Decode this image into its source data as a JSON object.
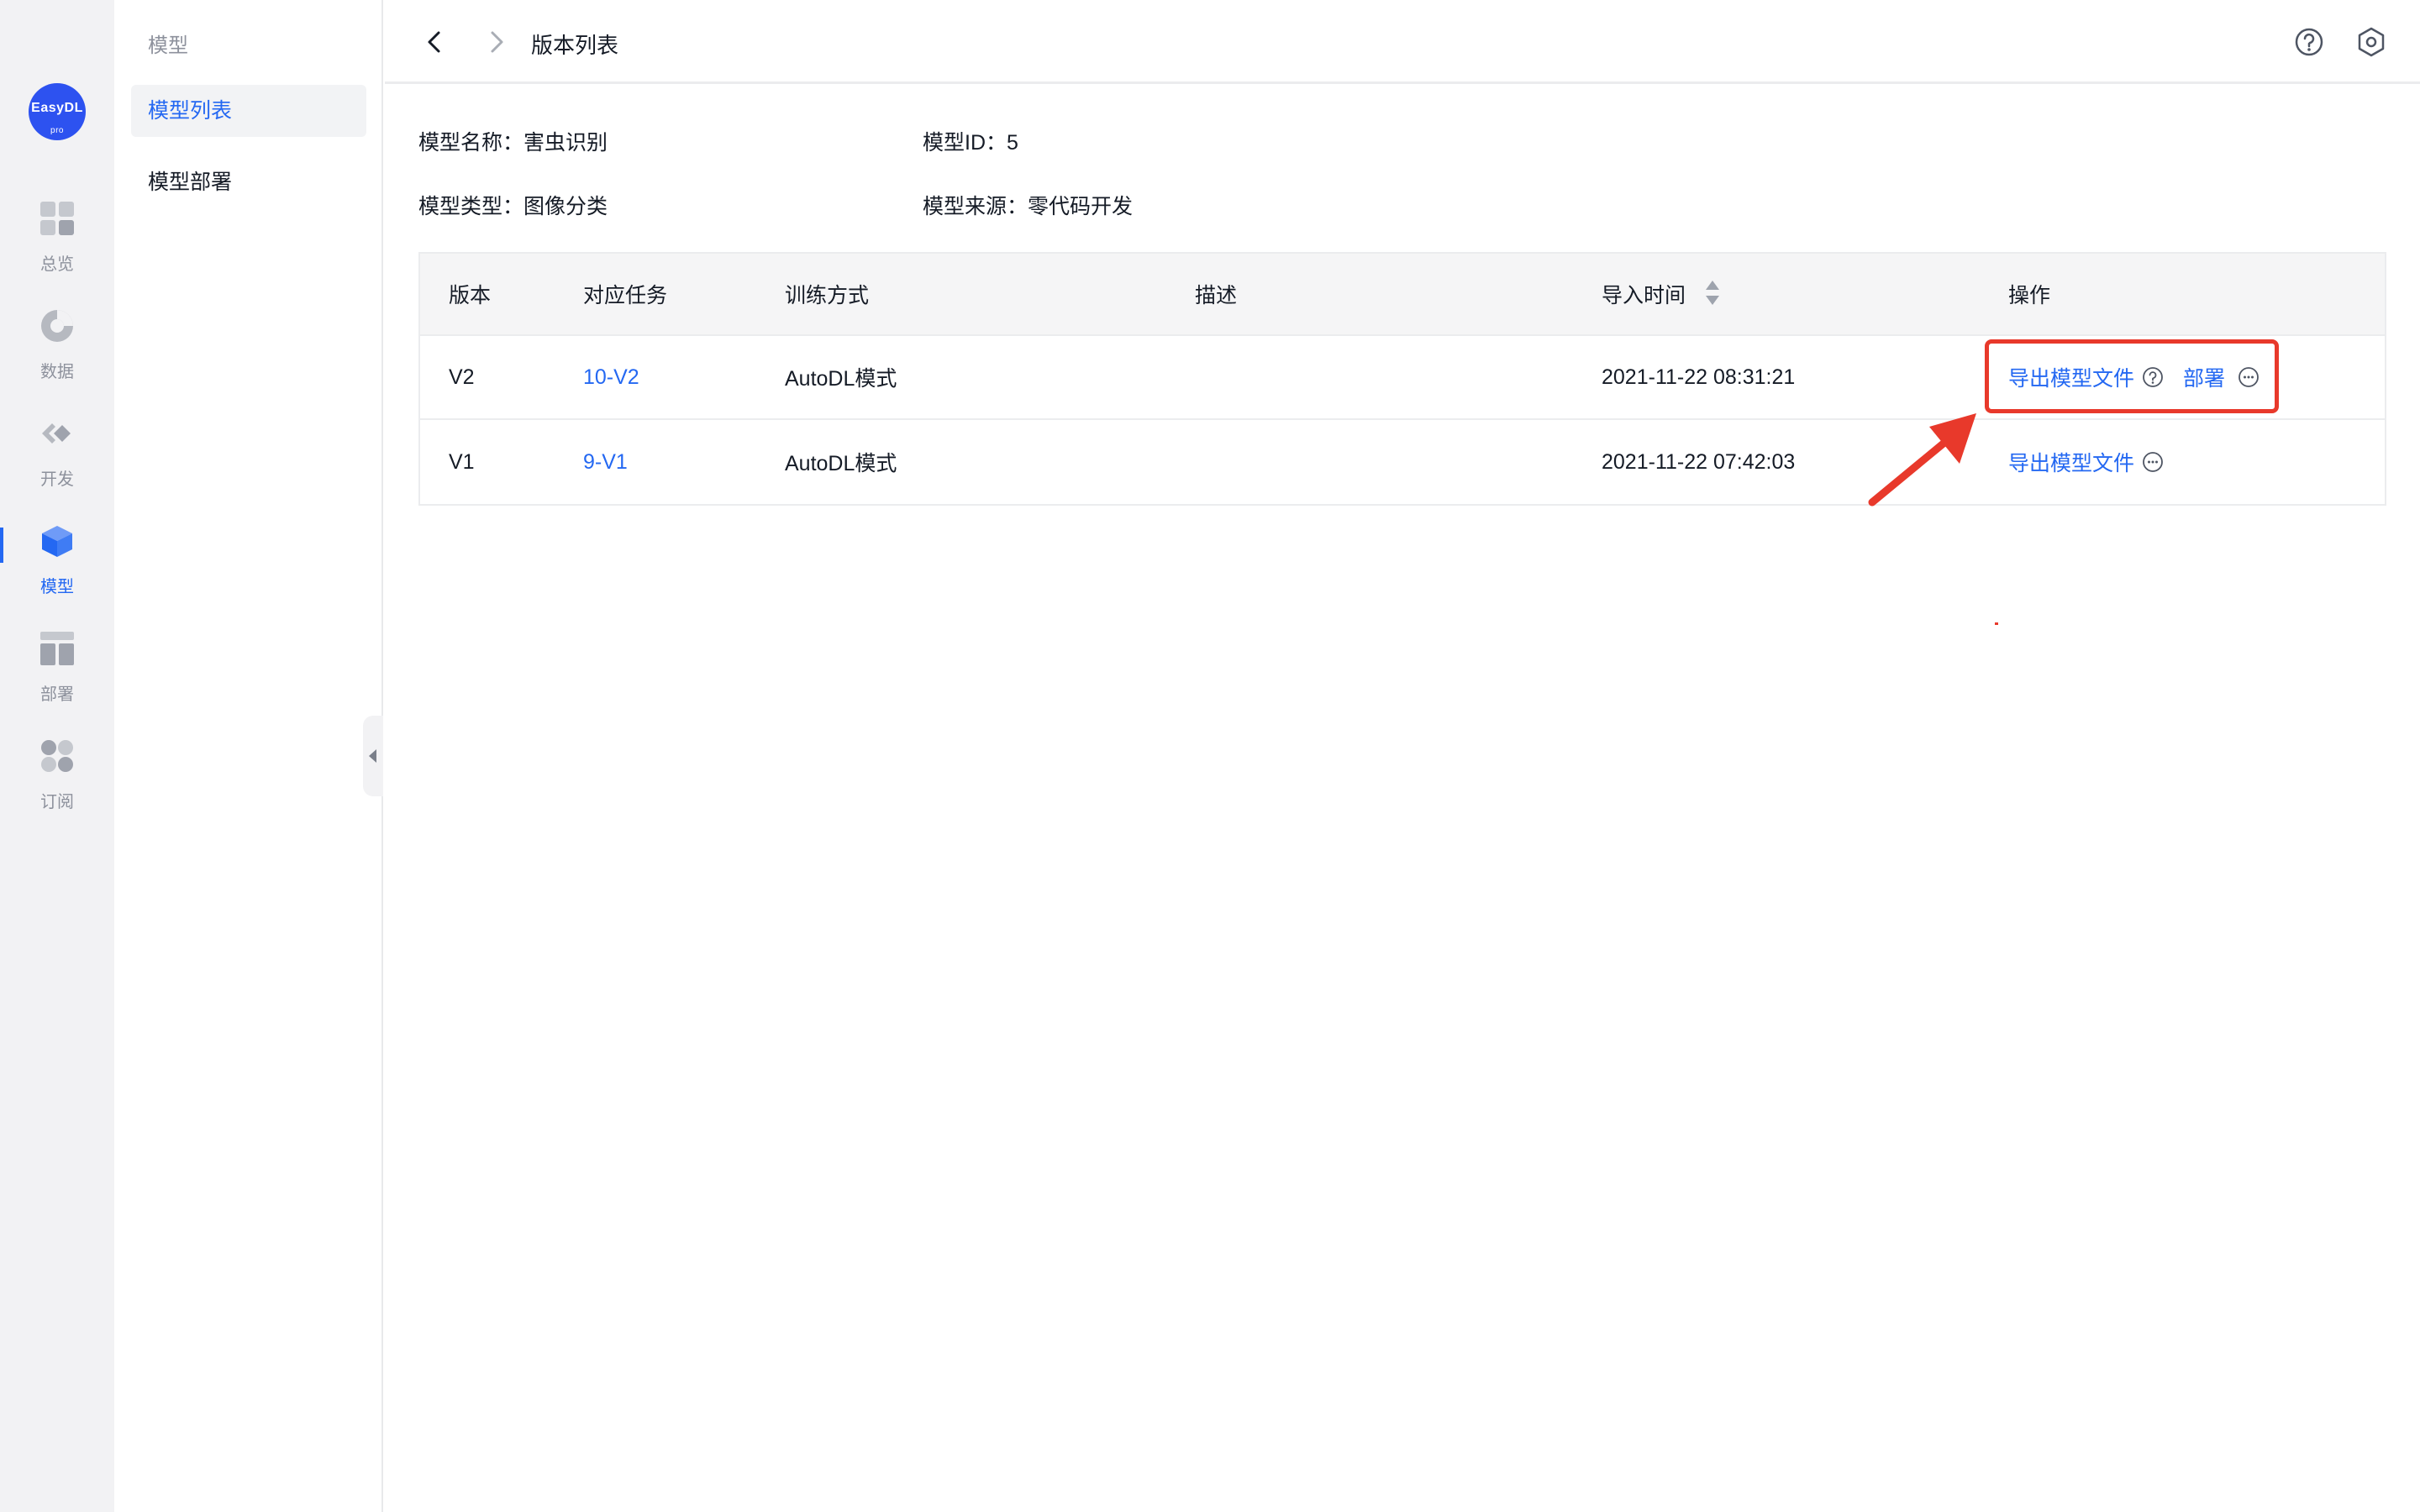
{
  "logo": {
    "text": "EasyDL",
    "sub": "pro"
  },
  "rail": {
    "items": [
      {
        "label": "总览",
        "icon": "dashboard-grid-icon"
      },
      {
        "label": "数据",
        "icon": "pie-chart-icon"
      },
      {
        "label": "开发",
        "icon": "code-diamond-icon"
      },
      {
        "label": "模型",
        "icon": "cube-icon",
        "active": true
      },
      {
        "label": "部署",
        "icon": "layout-blocks-icon"
      },
      {
        "label": "订阅",
        "icon": "clover-icon"
      }
    ]
  },
  "subnav": {
    "title": "模型",
    "items": [
      {
        "label": "模型列表",
        "active": true
      },
      {
        "label": "模型部署"
      }
    ]
  },
  "header": {
    "title": "版本列表"
  },
  "model_info": {
    "name_label": "模型名称：",
    "name_value": "害虫识别",
    "id_label": "模型ID：",
    "id_value": "5",
    "type_label": "模型类型：",
    "type_value": "图像分类",
    "source_label": "模型来源：",
    "source_value": "零代码开发"
  },
  "table": {
    "columns": [
      "版本",
      "对应任务",
      "训练方式",
      "描述",
      "导入时间",
      "操作"
    ],
    "rows": [
      {
        "version": "V2",
        "task": "10-V2",
        "training": "AutoDL模式",
        "description": "",
        "import_time": "2021-11-22  08:31:21",
        "export_label": "导出模型文件",
        "deploy_label": "部署"
      },
      {
        "version": "V1",
        "task": "9-V1",
        "training": "AutoDL模式",
        "description": "",
        "import_time": "2021-11-22  07:42:03",
        "export_label": "导出模型文件"
      }
    ]
  },
  "colors": {
    "accent": "#2468f2",
    "annotation": "#e8392b",
    "rail_bg": "#f2f2f4"
  }
}
